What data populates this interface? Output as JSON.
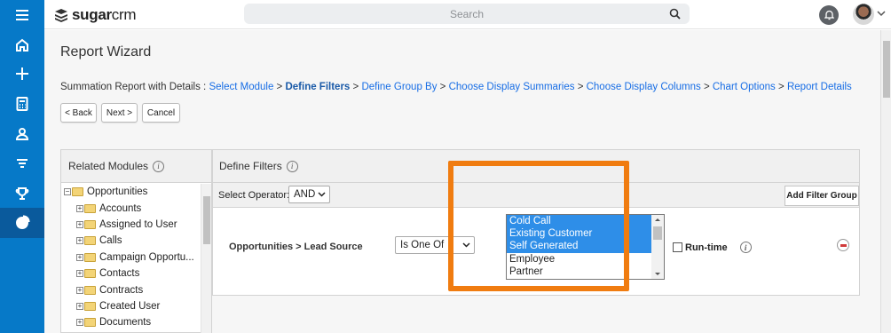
{
  "app": {
    "brand_bold": "sugar",
    "brand_light": "crm"
  },
  "topbar": {
    "search_placeholder": "Search"
  },
  "leftnav": {
    "items": [
      "menu-icon",
      "home-icon",
      "plus-icon",
      "calculator-icon",
      "contact-icon",
      "filter-icon",
      "trophy-icon",
      "reports-icon"
    ]
  },
  "page": {
    "title": "Report Wizard",
    "breadcrumb_prefix": "Summation Report with Details :",
    "steps": [
      "Select Module",
      "Define Filters",
      "Define Group By",
      "Choose Display Summaries",
      "Choose Display Columns",
      "Chart Options",
      "Report Details"
    ],
    "sep": ">"
  },
  "buttons": {
    "back": "< Back",
    "next": "Next >",
    "cancel": "Cancel"
  },
  "related_modules": {
    "title": "Related Modules",
    "root": "Opportunities",
    "items": [
      "Accounts",
      "Assigned to User",
      "Calls",
      "Campaign Opportu...",
      "Contacts",
      "Contracts",
      "Created User",
      "Documents"
    ]
  },
  "define_filters": {
    "title": "Define Filters",
    "operator_label": "Select Operator:",
    "operator_value": "AND",
    "add_group": "Add Filter Group",
    "filter": {
      "field": "Opportunities > Lead Source",
      "qualifier": "Is One Of",
      "options": [
        "Cold Call",
        "Existing Customer",
        "Self Generated",
        "Employee",
        "Partner"
      ],
      "selected": [
        "Cold Call",
        "Existing Customer",
        "Self Generated"
      ],
      "runtime_label": "Run-time"
    }
  },
  "colors": {
    "nav": "#0679c8",
    "link": "#176de5",
    "highlight": "#f07c10",
    "selected": "#2e8ee8"
  }
}
